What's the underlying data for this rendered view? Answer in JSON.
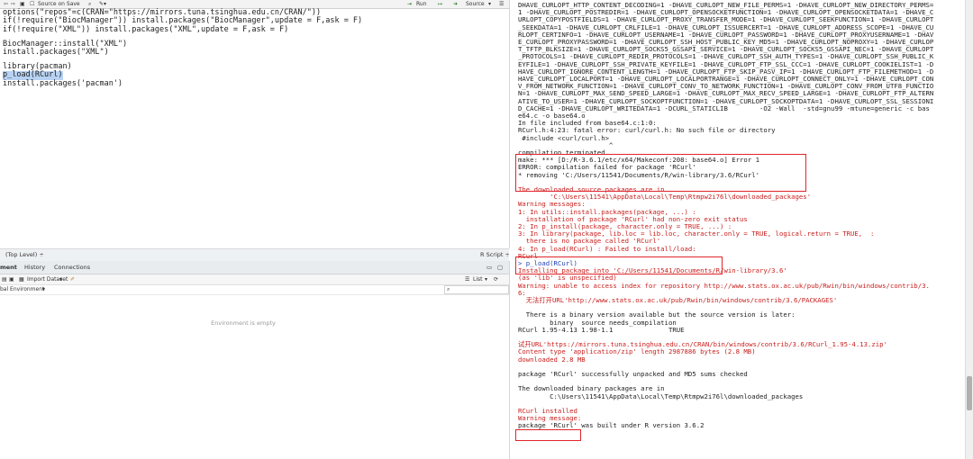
{
  "editor": {
    "toolbar": {
      "source_on_save": "Source on Save",
      "run": "Run",
      "source": "Source"
    },
    "code_lines": [
      "options(\"repos\"=c(CRAN=\"https://mirrors.tuna.tsinghua.edu.cn/CRAN/\"))",
      "if(!require(\"BiocManager\")) install.packages(\"BiocManager\",update = F,ask = F)",
      "if(!require(\"XML\")) install.packages(\"XML\",update = F,ask = F)",
      "",
      "BiocManager::install(\"XML\")",
      "install.packages(\"XML\")",
      "",
      "library(pacman)",
      "p_load(RCurl)",
      "install.packages('pacman')"
    ],
    "status_left": "(Top Level) ÷",
    "status_right": "R Script ÷"
  },
  "env": {
    "tabs": [
      "ment",
      "History",
      "Connections"
    ],
    "import_dataset": "Import Dataset",
    "list_view": "List",
    "scope": "bal Environment",
    "empty_message": "Environment is empty"
  },
  "console": {
    "lines": [
      {
        "t": "DHAVE_CURLOPT_HTTP_CONTENT_DECODING=1 -DHAVE_CURLOPT_NEW_FILE_PERMS=1 -DHAVE_CURLOPT_NEW_DIRECTORY_PERMS=",
        "c": "n"
      },
      {
        "t": "1 -DHAVE_CURLOPT_POSTREDIR=1 -DHAVE_CURLOPT_OPENSOCKETFUNCTION=1 -DHAVE_CURLOPT_OPENSOCKETDATA=1 -DHAVE_C",
        "c": "n"
      },
      {
        "t": "URLOPT_COPYPOSTFIELDS=1 -DHAVE_CURLOPT_PROXY_TRANSFER_MODE=1 -DHAVE_CURLOPT_SEEKFUNCTION=1 -DHAVE_CURLOPT",
        "c": "n"
      },
      {
        "t": "_SEEKDATA=1 -DHAVE_CURLOPT_CRLFILE=1 -DHAVE_CURLOPT_ISSUERCERT=1 -DHAVE_CURLOPT_ADDRESS_SCOPE=1 -DHAVE_CU",
        "c": "n"
      },
      {
        "t": "RLOPT_CERTINFO=1 -DHAVE_CURLOPT_USERNAME=1 -DHAVE_CURLOPT_PASSWORD=1 -DHAVE_CURLOPT_PROXYUSERNAME=1 -DHAV",
        "c": "n"
      },
      {
        "t": "E_CURLOPT_PROXYPASSWORD=1 -DHAVE_CURLOPT_SSH_HOST_PUBLIC_KEY_MD5=1 -DHAVE_CURLOPT_NOPROXY=1 -DHAVE_CURLOP",
        "c": "n"
      },
      {
        "t": "T_TFTP_BLKSIZE=1 -DHAVE_CURLOPT_SOCKS5_GSSAPI_SERVICE=1 -DHAVE_CURLOPT_SOCKS5_GSSAPI_NEC=1 -DHAVE_CURLOPT",
        "c": "n"
      },
      {
        "t": "_PROTOCOLS=1 -DHAVE_CURLOPT_REDIR_PROTOCOLS=1 -DHAVE_CURLOPT_SSH_AUTH_TYPES=1 -DHAVE_CURLOPT_SSH_PUBLIC_K",
        "c": "n"
      },
      {
        "t": "EYFILE=1 -DHAVE_CURLOPT_SSH_PRIVATE_KEYFILE=1 -DHAVE_CURLOPT_FTP_SSL_CCC=1 -DHAVE_CURLOPT_COOKIELIST=1 -D",
        "c": "n"
      },
      {
        "t": "HAVE_CURLOPT_IGNORE_CONTENT_LENGTH=1 -DHAVE_CURLOPT_FTP_SKIP_PASV_IP=1 -DHAVE_CURLOPT_FTP_FILEMETHOD=1 -D",
        "c": "n"
      },
      {
        "t": "HAVE_CURLOPT_LOCALPORT=1 -DHAVE_CURLOPT_LOCALPORTRANGE=1 -DHAVE_CURLOPT_CONNECT_ONLY=1 -DHAVE_CURLOPT_CON",
        "c": "n"
      },
      {
        "t": "V_FROM_NETWORK_FUNCTION=1 -DHAVE_CURLOPT_CONV_TO_NETWORK_FUNCTION=1 -DHAVE_CURLOPT_CONV_FROM_UTF8_FUNCTIO",
        "c": "n"
      },
      {
        "t": "N=1 -DHAVE_CURLOPT_MAX_SEND_SPEED_LARGE=1 -DHAVE_CURLOPT_MAX_RECV_SPEED_LARGE=1 -DHAVE_CURLOPT_FTP_ALTERN",
        "c": "n"
      },
      {
        "t": "ATIVE_TO_USER=1 -DHAVE_CURLOPT_SOCKOPTFUNCTION=1 -DHAVE_CURLOPT_SOCKOPTDATA=1 -DHAVE_CURLOPT_SSL_SESSIONI",
        "c": "n"
      },
      {
        "t": "D_CACHE=1 -DHAVE_CURLOPT_WRITEDATA=1 -DCURL_STATICLIB        -O2 -Wall  -std=gnu99 -mtune=generic -c bas",
        "c": "n"
      },
      {
        "t": "e64.c -o base64.o",
        "c": "n"
      },
      {
        "t": "In file included from base64.c:1:0:",
        "c": "n"
      },
      {
        "t": "RCurl.h:4:23: fatal error: curl/curl.h: No such file or directory",
        "c": "n"
      },
      {
        "t": " #include <curl/curl.h>",
        "c": "n"
      },
      {
        "t": "                       ^",
        "c": "n"
      },
      {
        "t": "compilation terminated.",
        "c": "n"
      },
      {
        "t": "make: *** [D:/R-3.6.1/etc/x64/Makeconf:208: base64.o] Error 1",
        "c": "n"
      },
      {
        "t": "ERROR: compilation failed for package 'RCurl'",
        "c": "n"
      },
      {
        "t": "* removing 'C:/Users/11541/Documents/R/win-library/3.6/RCurl'",
        "c": "n"
      },
      {
        "t": "",
        "c": "n"
      },
      {
        "t": "The downloaded source packages are in",
        "c": "red"
      },
      {
        "t": "        'C:\\Users\\11541\\AppData\\Local\\Temp\\Rtmpw2i76l\\downloaded_packages'",
        "c": "red"
      },
      {
        "t": "Warning messages:",
        "c": "red"
      },
      {
        "t": "1: In utils::install.packages(package, ...) :",
        "c": "red"
      },
      {
        "t": "  installation of package 'RCurl' had non-zero exit status",
        "c": "red"
      },
      {
        "t": "2: In p_install(package, character.only = TRUE, ...) :",
        "c": "red"
      },
      {
        "t": "3: In library(package, lib.loc = lib.loc, character.only = TRUE, logical.return = TRUE,  :",
        "c": "red"
      },
      {
        "t": "  there is no package called 'RCurl'",
        "c": "red"
      },
      {
        "t": "4: In p_load(RCurl) : Failed to install/load:",
        "c": "red"
      },
      {
        "t": "RCurl",
        "c": "red"
      },
      {
        "t": "> p_load(RCurl)",
        "c": "blue"
      },
      {
        "t": "Installing package into 'C:/Users/11541/Documents/R/win-library/3.6'",
        "c": "red"
      },
      {
        "t": "(as 'lib' is unspecified)",
        "c": "red"
      },
      {
        "t": "Warning: unable to access index for repository http://www.stats.ox.ac.uk/pub/Rwin/bin/windows/contrib/3.",
        "c": "red"
      },
      {
        "t": "6:",
        "c": "red"
      },
      {
        "t": "  无法打开URL'http://www.stats.ox.ac.uk/pub/Rwin/bin/windows/contrib/3.6/PACKAGES'",
        "c": "red"
      },
      {
        "t": "",
        "c": "n"
      },
      {
        "t": "  There is a binary version available but the source version is later:",
        "c": "n"
      },
      {
        "t": "        binary  source needs_compilation",
        "c": "n"
      },
      {
        "t": "RCurl 1.95-4.13 1.98-1.1              TRUE",
        "c": "n"
      },
      {
        "t": "",
        "c": "n"
      },
      {
        "t": "试开URL'https://mirrors.tuna.tsinghua.edu.cn/CRAN/bin/windows/contrib/3.6/RCurl_1.95-4.13.zip'",
        "c": "red"
      },
      {
        "t": "Content type 'application/zip' length 2987886 bytes (2.8 MB)",
        "c": "red"
      },
      {
        "t": "downloaded 2.8 MB",
        "c": "red"
      },
      {
        "t": "",
        "c": "n"
      },
      {
        "t": "package 'RCurl' successfully unpacked and MD5 sums checked",
        "c": "n"
      },
      {
        "t": "",
        "c": "n"
      },
      {
        "t": "The downloaded binary packages are in",
        "c": "n"
      },
      {
        "t": "        C:\\Users\\11541\\AppData\\Local\\Temp\\Rtmpw2i76l\\downloaded_packages",
        "c": "n"
      },
      {
        "t": "",
        "c": "n"
      },
      {
        "t": "RCurl installed",
        "c": "red"
      },
      {
        "t": "Warning message:",
        "c": "red"
      },
      {
        "t": "package 'RCurl' was built under R version 3.6.2",
        "c": "n"
      }
    ]
  },
  "colors": {
    "highlight_box": "#e0252b",
    "console_error": "#c8201e",
    "console_prompt": "#2342b3"
  }
}
